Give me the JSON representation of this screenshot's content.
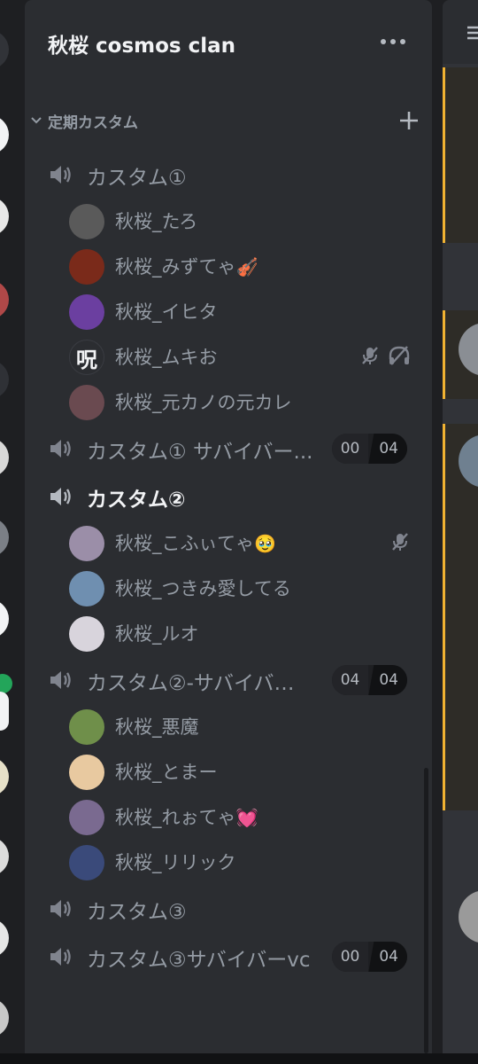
{
  "server": {
    "name": "秋桜 cosmos clan",
    "menu_icon": "more-dots-icon"
  },
  "category": {
    "label": "定期カスタム",
    "collapse_icon": "chevron-down-icon",
    "add_icon": "plus-icon"
  },
  "channels": [
    {
      "name": "カスタム①",
      "icon": "speaker-icon",
      "active": false,
      "members": [
        {
          "name": "秋桜_たろ",
          "emoji": "",
          "avatar_color": "#5a5a5a",
          "muted": false,
          "deafened": false
        },
        {
          "name": "秋桜_みずてゃ",
          "emoji": "🎻",
          "avatar_color": "#7a2a1a",
          "muted": false,
          "deafened": false
        },
        {
          "name": "秋桜_イヒタ",
          "emoji": "",
          "avatar_color": "#6b3fa0",
          "muted": false,
          "deafened": false
        },
        {
          "name": "秋桜_ムキお",
          "emoji": "",
          "avatar_color": "#2b2d31",
          "avatar_text": "呪",
          "muted": true,
          "deafened": true
        },
        {
          "name": "秋桜_元カノの元カレ",
          "emoji": "",
          "avatar_color": "#6a4a50",
          "muted": false,
          "deafened": false
        }
      ]
    },
    {
      "name": "カスタム① サバイバー...",
      "icon": "speaker-icon",
      "active": false,
      "count": "00",
      "limit": "04",
      "members": []
    },
    {
      "name": "カスタム②",
      "icon": "speaker-icon",
      "active": true,
      "members": [
        {
          "name": "秋桜_こふぃてゃ",
          "emoji": "🥹",
          "avatar_color": "#9b8ea8",
          "muted": true,
          "deafened": false
        },
        {
          "name": "秋桜_つきみ愛してる",
          "emoji": "",
          "avatar_color": "#6f8fb0",
          "muted": false,
          "deafened": false
        },
        {
          "name": "秋桜_ルオ",
          "emoji": "",
          "avatar_color": "#d8d4dc",
          "muted": false,
          "deafened": false
        }
      ]
    },
    {
      "name": "カスタム②-サバイバ…",
      "icon": "speaker-icon",
      "active": false,
      "count": "04",
      "limit": "04",
      "members": [
        {
          "name": "秋桜_悪魔",
          "emoji": "",
          "avatar_color": "#6f8f4a",
          "muted": false,
          "deafened": false
        },
        {
          "name": "秋桜_とまー",
          "emoji": "",
          "avatar_color": "#e8c9a0",
          "muted": false,
          "deafened": false
        },
        {
          "name": "秋桜_れぉてゃ",
          "emoji": "💓",
          "avatar_color": "#7a6a90",
          "muted": false,
          "deafened": false
        },
        {
          "name": "秋桜_リリック",
          "emoji": "",
          "avatar_color": "#3a4a7a",
          "muted": false,
          "deafened": false
        }
      ]
    },
    {
      "name": "カスタム③",
      "icon": "speaker-icon",
      "active": false,
      "members": []
    },
    {
      "name": "カスタム③サバイバーvc",
      "icon": "speaker-icon",
      "active": false,
      "count": "00",
      "limit": "04",
      "members": []
    }
  ],
  "colors": {
    "panel": "#2b2d31",
    "rail": "#1e1f22",
    "text_muted": "#949ba4",
    "text_active": "#f2f3f5",
    "highlight": "#f0b232"
  }
}
